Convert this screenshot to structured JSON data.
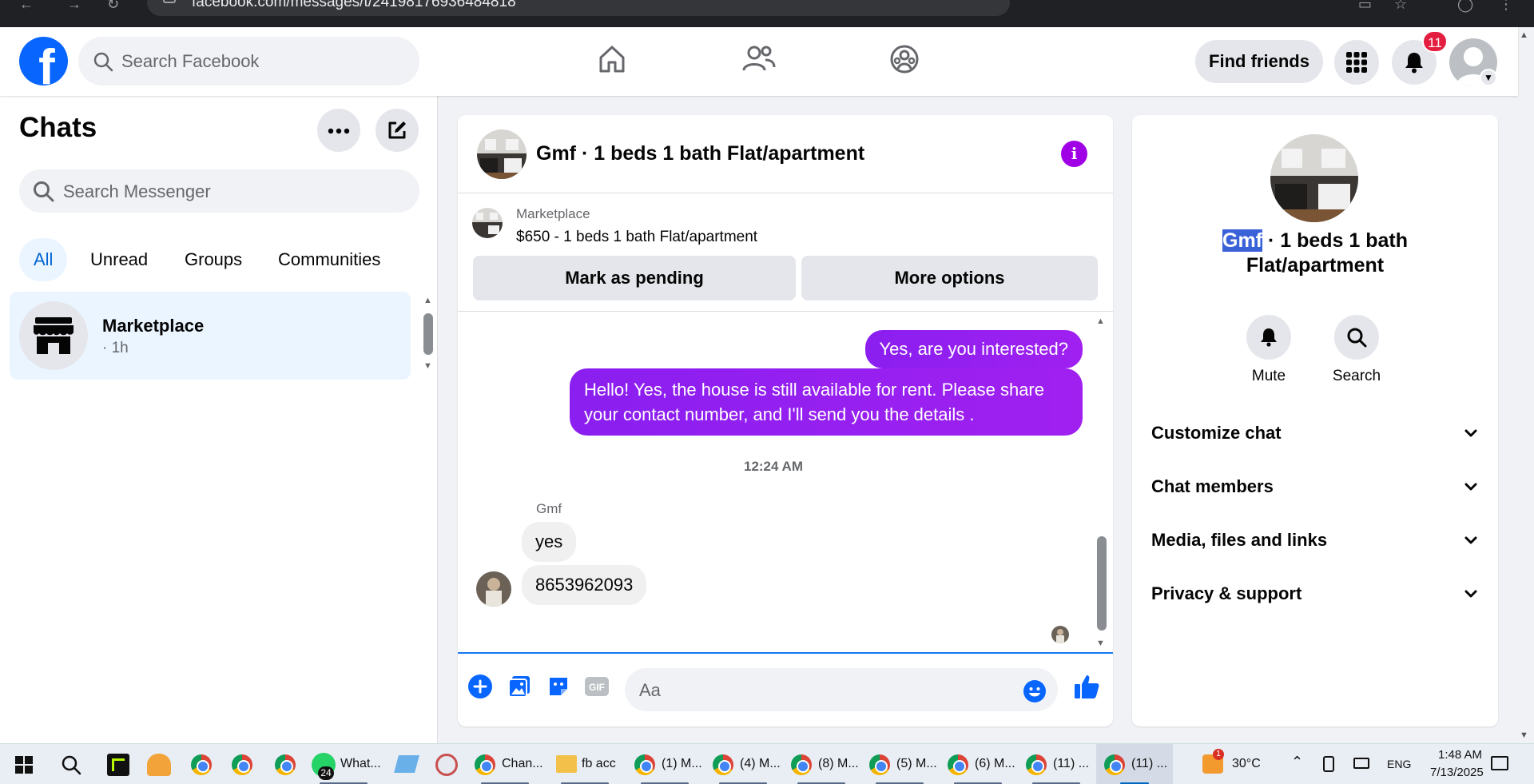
{
  "browser": {
    "url": "facebook.com/messages/t/24198176936484818"
  },
  "header": {
    "logo": "f",
    "search_placeholder": "Search Facebook",
    "find_friends_label": "Find friends",
    "notification_count": "11",
    "nav_icons": [
      "home-icon",
      "friends-icon",
      "groups-icon"
    ]
  },
  "chats": {
    "title": "Chats",
    "search_placeholder": "Search Messenger",
    "tabs": [
      {
        "label": "All",
        "active": true
      },
      {
        "label": "Unread",
        "active": false
      },
      {
        "label": "Groups",
        "active": false
      },
      {
        "label": "Communities",
        "active": false
      }
    ],
    "items": [
      {
        "name": "Marketplace",
        "time": "· 1h"
      }
    ]
  },
  "conversation": {
    "title": "Gmf · 1 beds 1 bath Flat/apartment",
    "marketplace_label": "Marketplace",
    "listing": "$650 - 1 beds 1 bath Flat/apartment",
    "mark_pending_label": "Mark as pending",
    "more_options_label": "More options",
    "messages": {
      "out1": "Yes, are you interested?",
      "out2_line1": "Hello! Yes, the house is still available for rent. Please share",
      "out2_line2": "your contact number, and I'll send you the details .",
      "timestamp": "12:24 AM",
      "sender": "Gmf",
      "in1": "yes",
      "in2": "8653962093"
    },
    "composer_placeholder": "Aa"
  },
  "info": {
    "name_highlight": "Gmf",
    "name_rest_line1": " · 1 beds 1 bath",
    "name_line2": "Flat/apartment",
    "mute_label": "Mute",
    "search_label": "Search",
    "rows": [
      "Customize chat",
      "Chat members",
      "Media, files and links",
      "Privacy & support"
    ]
  },
  "taskbar": {
    "items": [
      {
        "label": "What...",
        "badge": "24"
      },
      {
        "label": "Chan..."
      },
      {
        "label": "fb acc"
      },
      {
        "label": "(1) M..."
      },
      {
        "label": "(4) M..."
      },
      {
        "label": "(8) M..."
      },
      {
        "label": "(5) M..."
      },
      {
        "label": "(6) M..."
      },
      {
        "label": "(11) ..."
      },
      {
        "label": "(11) ..."
      }
    ],
    "weather_badge": "1",
    "temperature": "30°C",
    "language": "ENG",
    "time": "1:48 AM",
    "date": "7/13/2025"
  },
  "colors": {
    "fb_blue": "#0866ff",
    "messenger_purple": "#9320f5",
    "notification_red": "#e41e3f"
  }
}
